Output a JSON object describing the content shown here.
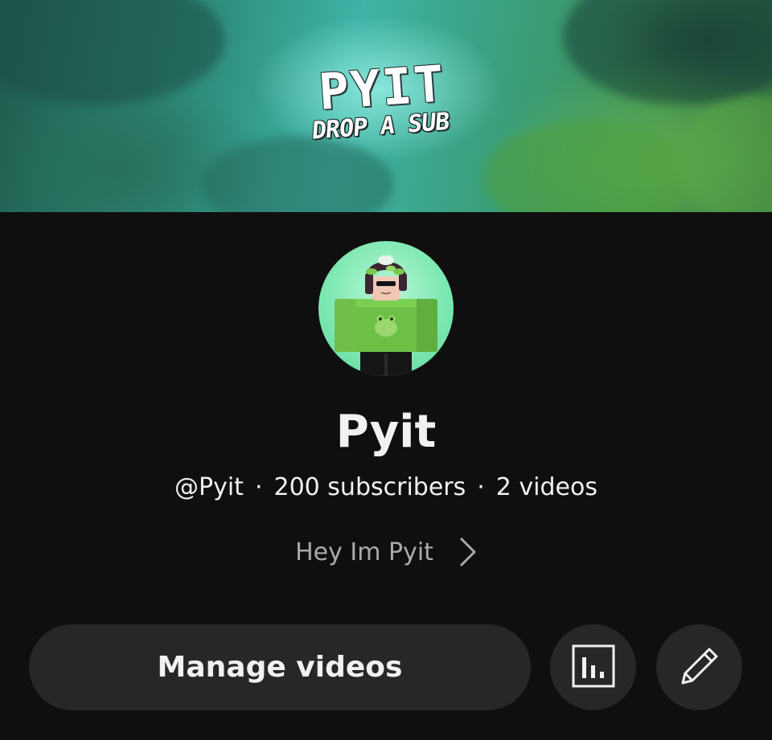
{
  "banner": {
    "logo_title": "PYIT",
    "logo_subtitle": "DROP A SUB"
  },
  "channel": {
    "name": "Pyit",
    "handle": "@Pyit",
    "separator": "·",
    "subscribers": "200 subscribers",
    "videos": "2 videos",
    "description": "Hey Im Pyit"
  },
  "actions": {
    "manage_videos_label": "Manage videos",
    "analytics_icon": "analytics-icon",
    "edit_icon": "pencil-icon"
  },
  "colors": {
    "background": "#0f0f0f",
    "button_bg": "#272727",
    "primary_text": "#f1f1f1",
    "secondary_text": "#aaaaaa",
    "avatar_bg": "#7ee8b2"
  }
}
